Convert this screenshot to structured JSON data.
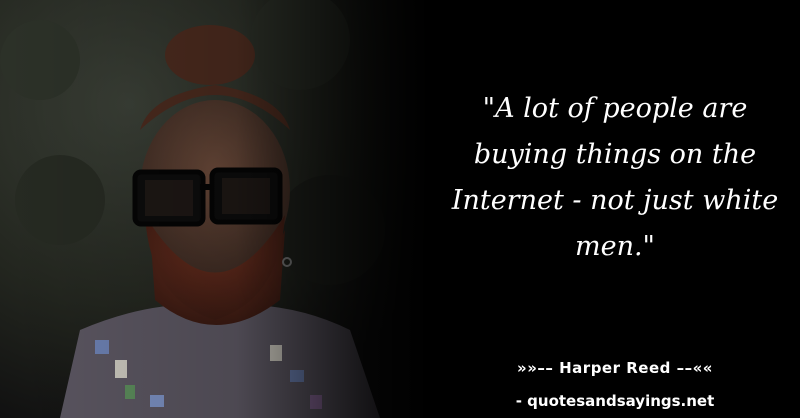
{
  "quote": {
    "text": "\"A lot of people are buying things on the Internet - not just white men.\""
  },
  "attribution": {
    "author_line": "»»–– Harper Reed ––««",
    "source": "- quotesandsayings.net"
  }
}
